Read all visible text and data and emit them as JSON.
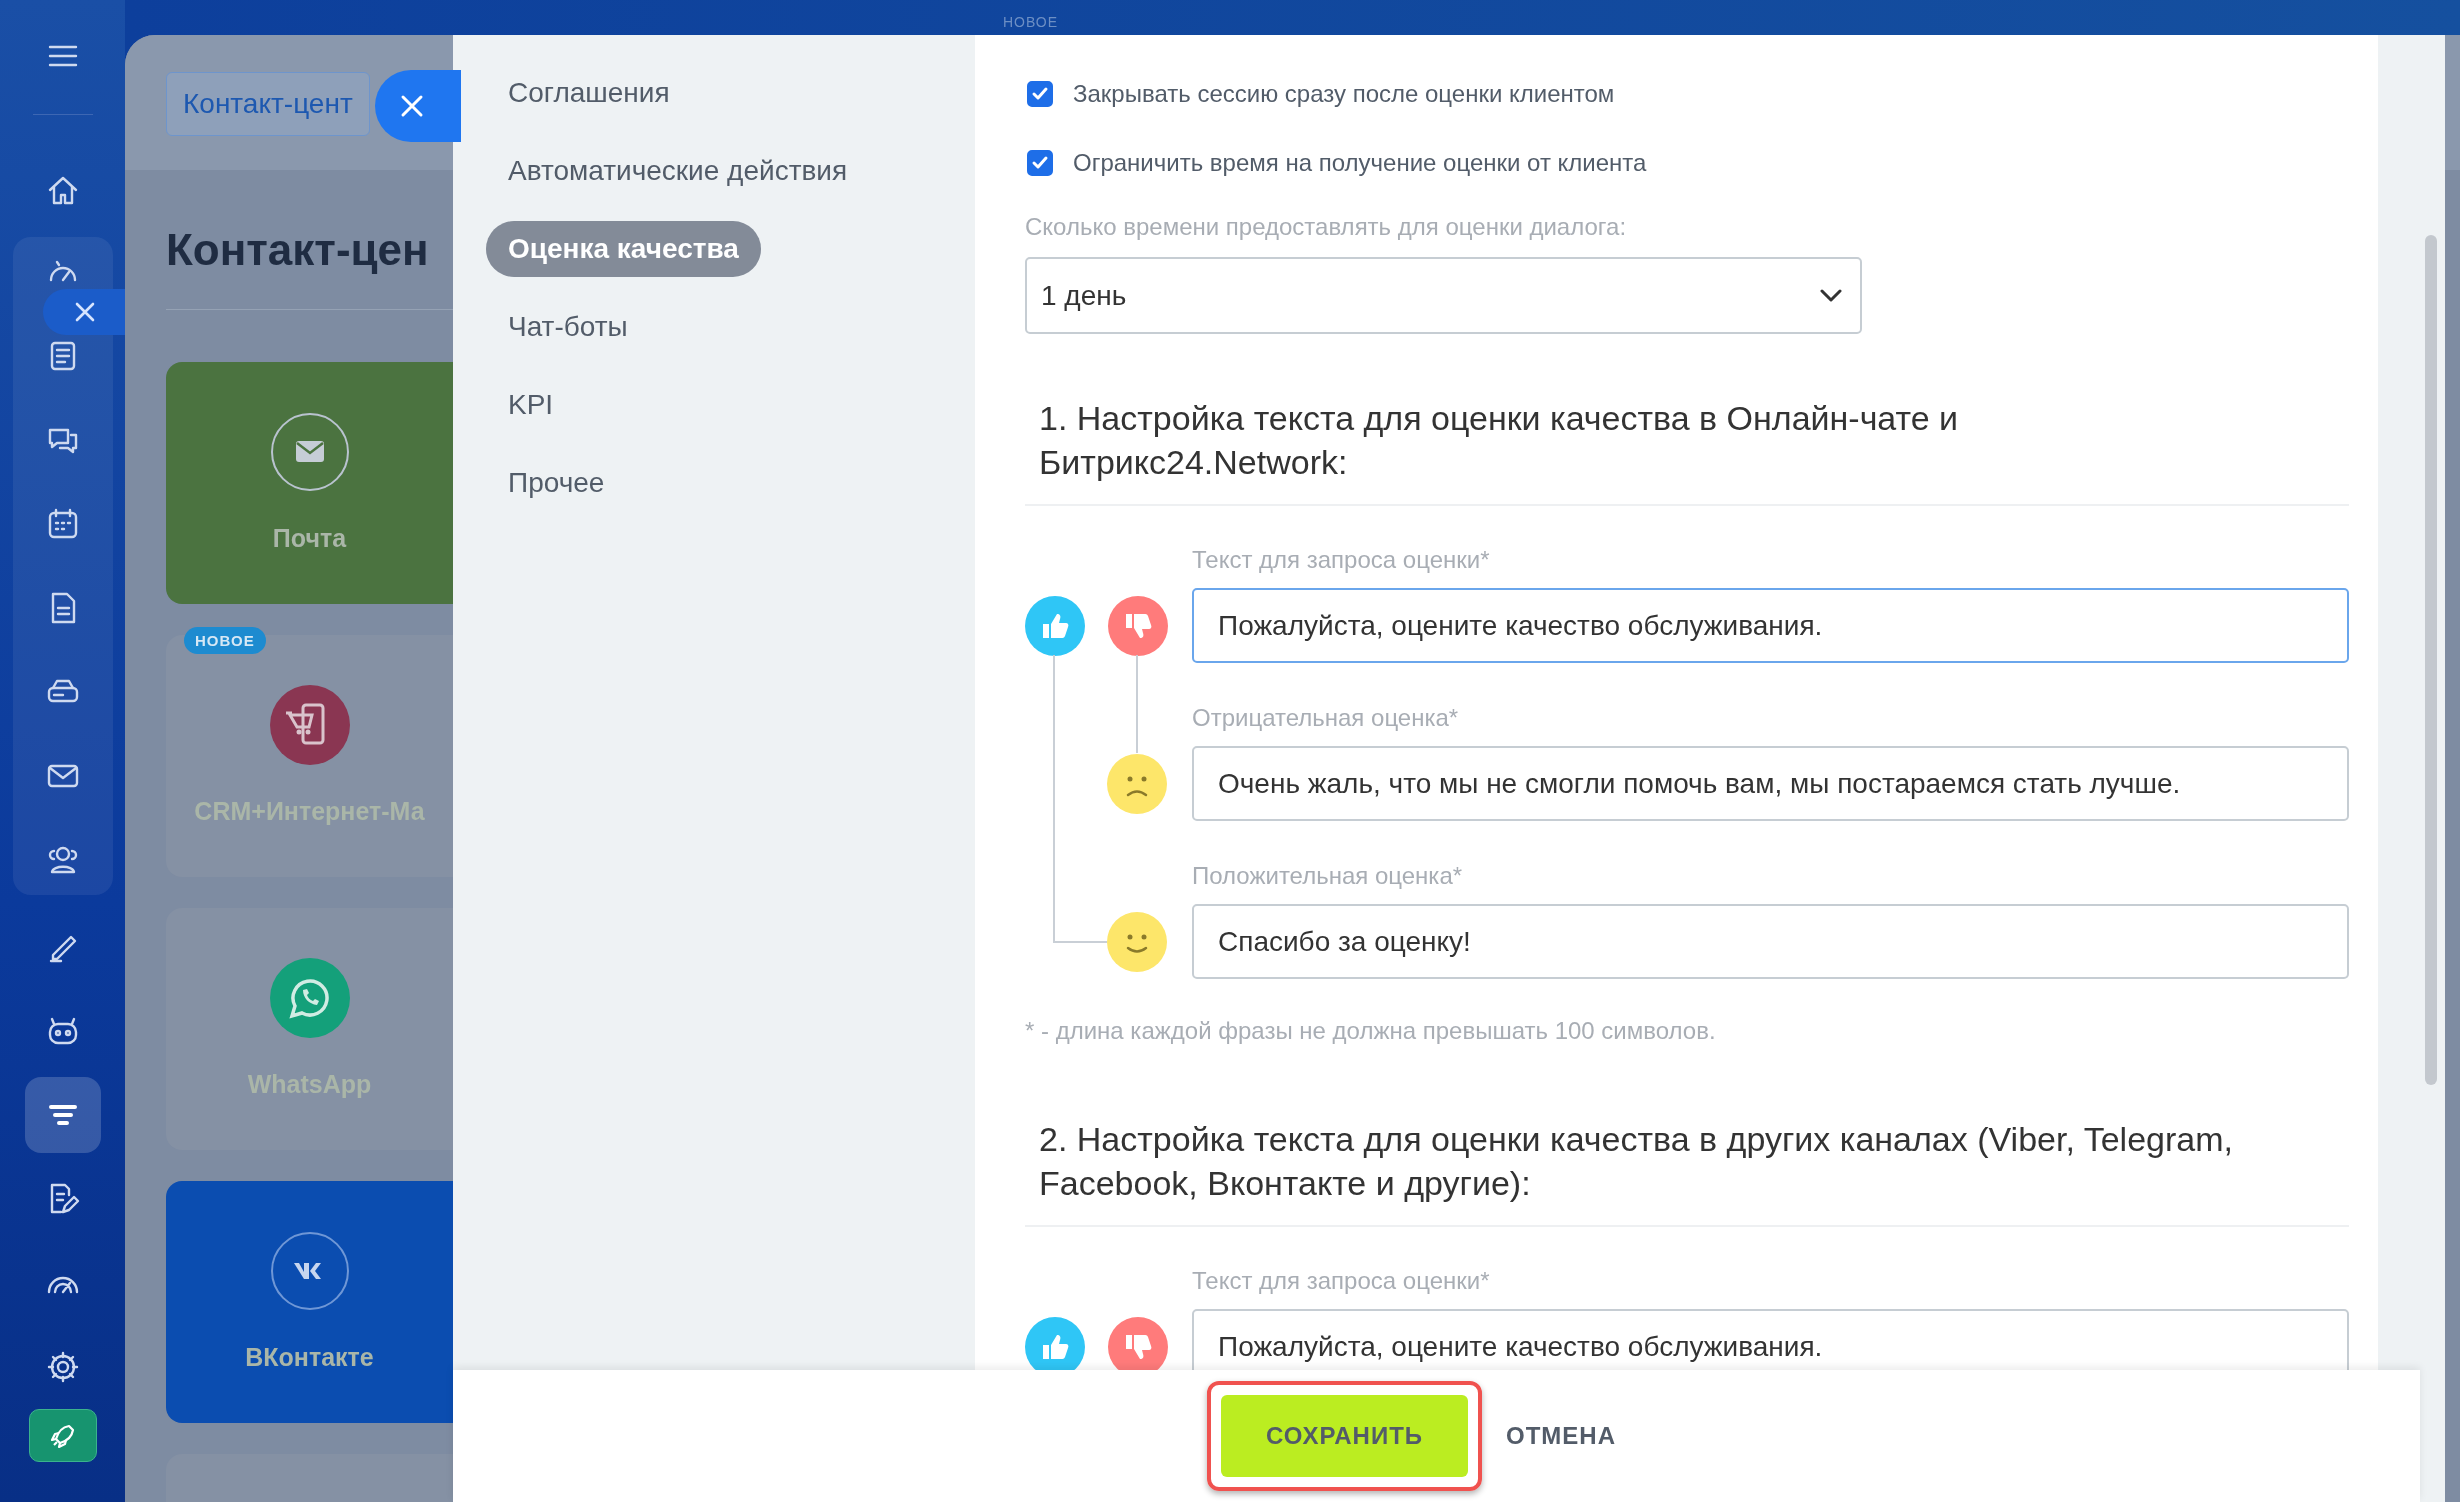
{
  "top_bar": {
    "badge": "НОВОЕ"
  },
  "sidebar": {
    "groups": [
      {
        "boxed": false,
        "items": [
          {
            "kind": "menu",
            "selected": false
          }
        ]
      },
      {
        "boxed": false,
        "items": [
          {
            "kind": "home",
            "selected": false
          }
        ]
      },
      {
        "boxed": true,
        "items": [
          {
            "kind": "activity",
            "selected": false
          },
          {
            "kind": "feed",
            "selected": false
          },
          {
            "kind": "chat",
            "selected": false
          },
          {
            "kind": "calendar",
            "selected": false
          },
          {
            "kind": "document",
            "selected": false
          },
          {
            "kind": "drive",
            "selected": false
          },
          {
            "kind": "mail",
            "selected": false
          },
          {
            "kind": "people",
            "selected": false
          }
        ]
      },
      {
        "boxed": false,
        "items": [
          {
            "kind": "pen",
            "selected": false
          },
          {
            "kind": "robot",
            "selected": false
          },
          {
            "kind": "funnel",
            "selected": true
          },
          {
            "kind": "docedit",
            "selected": false
          },
          {
            "kind": "gauge",
            "selected": false
          },
          {
            "kind": "gear",
            "selected": false
          }
        ]
      },
      {
        "boxed": false,
        "items": [
          {
            "kind": "rocket",
            "selected": false
          }
        ]
      }
    ]
  },
  "background_page": {
    "search_value": "Контакт-цент",
    "title": "Контакт-цен",
    "tiles": [
      {
        "kind": "mail",
        "label": "Почта",
        "color": "#4b7340"
      },
      {
        "kind": "shop",
        "label": "CRM+Интернет-Ма",
        "badge": "НОВОЕ",
        "color": "#8591a4"
      },
      {
        "kind": "whatsapp",
        "label": "WhatsApp",
        "color": "#8591a4"
      },
      {
        "kind": "vk",
        "label": "ВКонтакте",
        "color": "#0b4db0"
      },
      {
        "kind": "empty",
        "color": "#8591a4"
      }
    ]
  },
  "slider": {
    "menu": [
      {
        "label": "Соглашения",
        "selected": false
      },
      {
        "label": "Автоматические действия",
        "selected": false
      },
      {
        "label": "Оценка качества",
        "selected": true
      },
      {
        "label": "Чат-боты",
        "selected": false
      },
      {
        "label": "KPI",
        "selected": false
      },
      {
        "label": "Прочее",
        "selected": false
      }
    ],
    "options": [
      {
        "label": "Закрывать сессию сразу после оценки клиентом",
        "checked": true
      },
      {
        "label": "Ограничить время на получение оценки от клиента",
        "checked": true
      }
    ],
    "time_label": "Сколько времени предоставлять для оценки диалога:",
    "time_select": {
      "value": "1 день"
    },
    "sections": [
      {
        "heading": "1. Настройка текста для оценки качества в Онлайн-чате и Битрикс24.Network:",
        "fields": [
          {
            "kind": "request",
            "label": "Текст для запроса оценки*",
            "value": "Пожалуйста, оцените качество обслуживания.",
            "focused": true
          },
          {
            "kind": "negative",
            "label": "Отрицательная оценка*",
            "value": "Очень жаль, что мы не смогли помочь вам, мы постараемся стать лучше.",
            "focused": false
          },
          {
            "kind": "positive",
            "label": "Положительная оценка*",
            "value": "Спасибо за оценку!",
            "focused": false
          }
        ],
        "note": "* - длина каждой фразы не должна превышать 100 символов."
      },
      {
        "heading": "2. Настройка текста для оценки качества в других каналах (Viber, Telegram, Facebook, Вконтакте и другие):",
        "fields": [
          {
            "kind": "request",
            "label": "Текст для запроса оценки*",
            "value": "Пожалуйста, оцените качество обслуживания.",
            "focused": false
          }
        ]
      }
    ],
    "footer": {
      "save": "СОХРАНИТЬ",
      "cancel": "ОТМЕНА",
      "save_highlighted": true
    }
  }
}
